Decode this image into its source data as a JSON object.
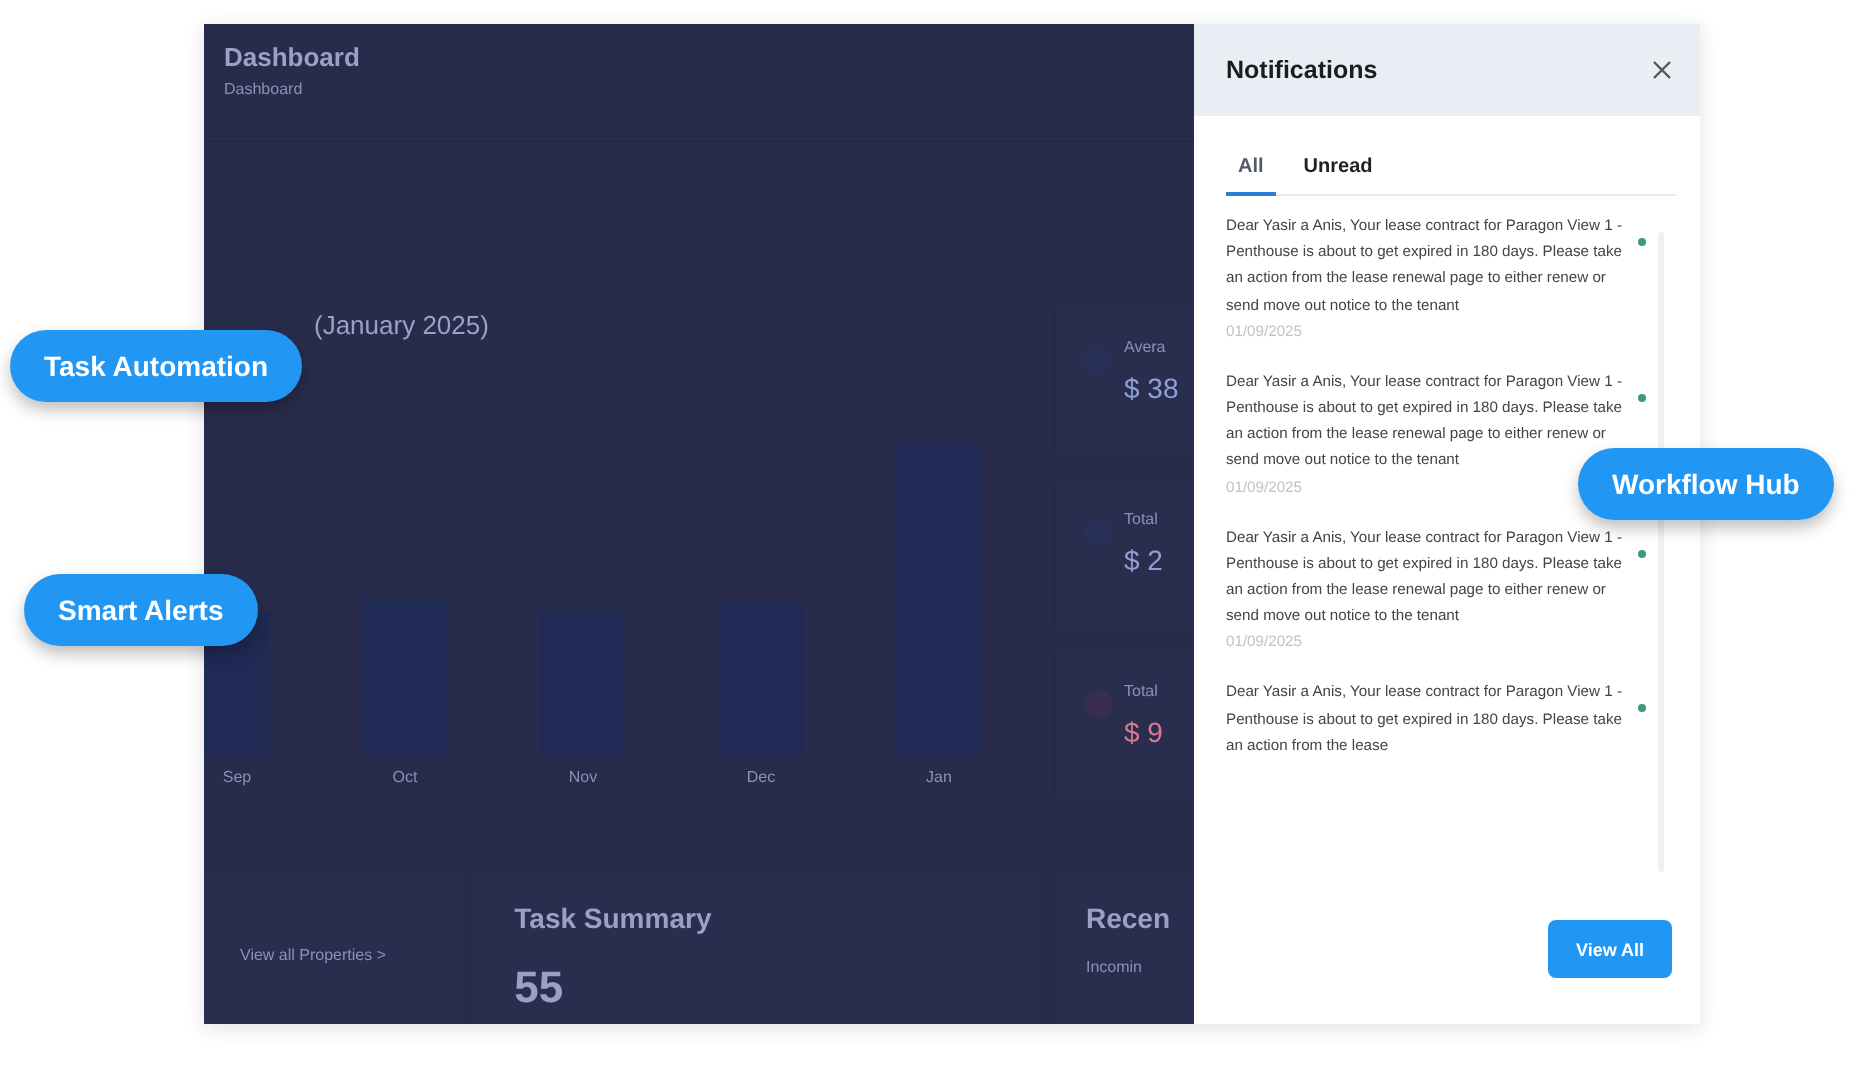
{
  "dashboard": {
    "title": "Dashboard",
    "breadcrumb": "Dashboard",
    "chart": {
      "title": "(January 2025)",
      "months": [
        "Sep",
        "Oct",
        "Nov",
        "Dec",
        "Jan"
      ]
    },
    "stats": [
      {
        "label": "Avera",
        "value": "$ 38",
        "alert": false
      },
      {
        "label": "Total",
        "value": "$ 2",
        "alert": false
      },
      {
        "label": "Total",
        "value": "$ 9",
        "alert": true
      }
    ],
    "properties_link": "View all Properties  >",
    "task_summary": {
      "title": "Task Summary",
      "count": "55"
    },
    "recent": {
      "title": "Recen",
      "subtitle": "Incomin"
    }
  },
  "notifications": {
    "title": "Notifications",
    "tabs": [
      {
        "label": "All",
        "selected": true
      },
      {
        "label": "Unread",
        "selected": false
      }
    ],
    "items": [
      {
        "text": "Dear Yasir a Anis, Your lease contract for Paragon View 1 - Penthouse is about to get expired in 180 days. Please take an action from the lease renewal page to either renew or send move out notice to the tenant",
        "date": "01/09/2025",
        "unread": true
      },
      {
        "text": "Dear Yasir a Anis, Your lease contract for Paragon View 1 - Penthouse is about to get expired in 180 days. Please take an action from the lease renewal page to either renew or send move out notice to the tenant",
        "date": "01/09/2025",
        "unread": true
      },
      {
        "text": "Dear Yasir a Anis, Your lease contract for Paragon View 1 - Penthouse is about to get expired in 180 days. Please take an action from the lease renewal page to either renew or send move out notice to the tenant",
        "date": "01/09/2025",
        "unread": true
      },
      {
        "text": "Dear Yasir a Anis, Your lease contract for Paragon View 1 - Penthouse is about to get expired in 180 days. Please take an action from the lease",
        "unread": true
      }
    ],
    "button": "View All"
  },
  "callouts": [
    "Task Automation",
    "Smart Alerts",
    "Workflow Hub"
  ]
}
